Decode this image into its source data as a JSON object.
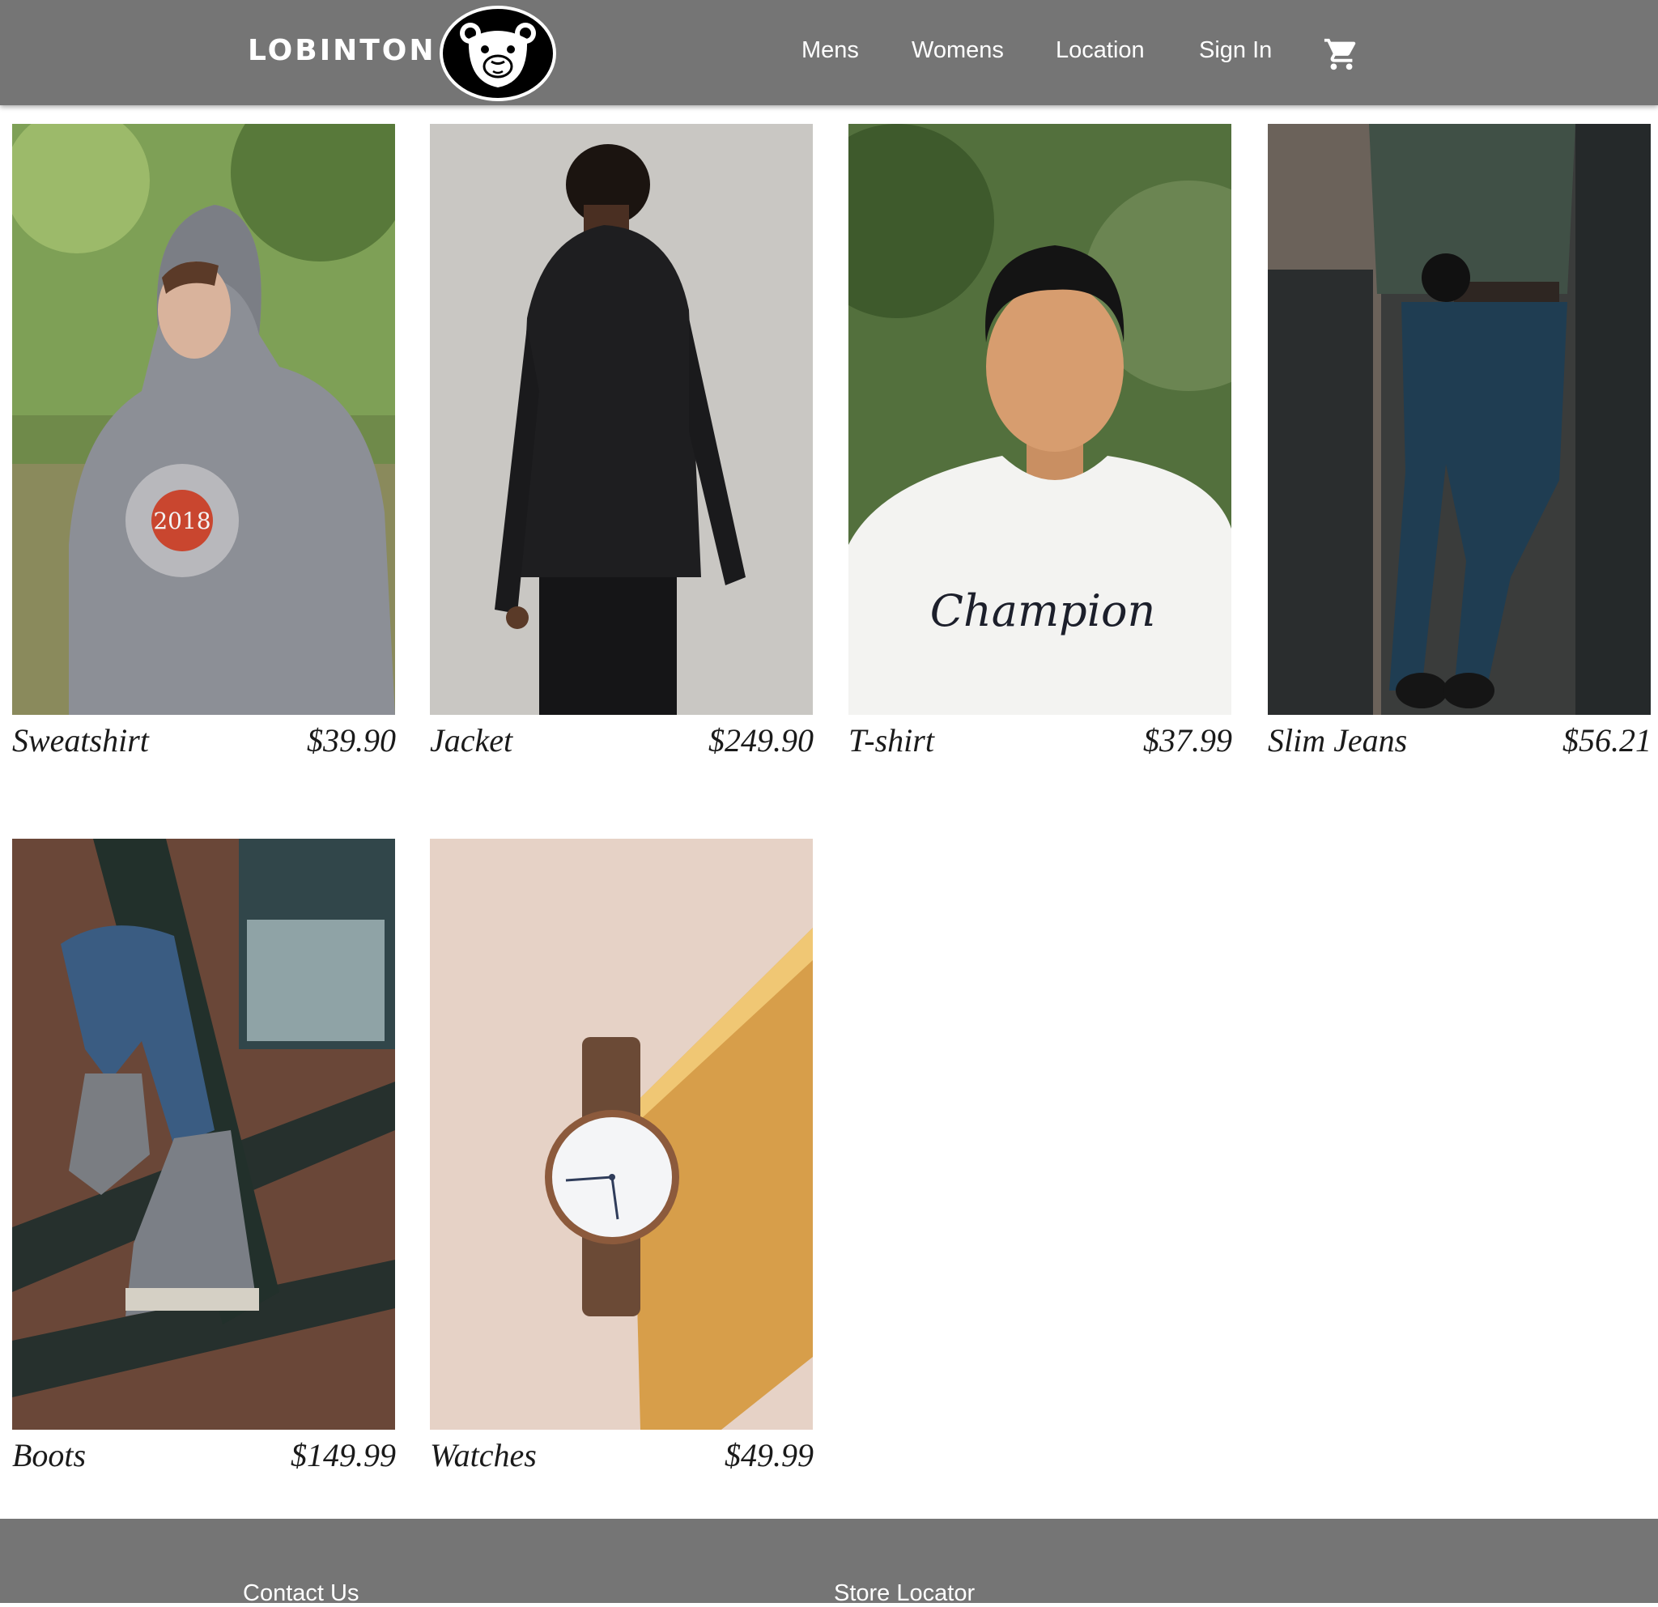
{
  "header": {
    "brand": "LOBINTON",
    "logo_icon": "bear-face-logo-icon",
    "nav": [
      {
        "label": "Mens"
      },
      {
        "label": "Womens"
      },
      {
        "label": "Location"
      },
      {
        "label": "Sign In"
      }
    ],
    "cart_icon": "shopping-cart-icon",
    "background": "#757575"
  },
  "products": [
    {
      "name": "Sweatshirt",
      "price": "$39.90"
    },
    {
      "name": "Jacket",
      "price": "$249.90"
    },
    {
      "name": "T-shirt",
      "price": "$37.99"
    },
    {
      "name": "Slim Jeans",
      "price": "$56.21"
    },
    {
      "name": "Boots",
      "price": "$149.99"
    },
    {
      "name": "Watches",
      "price": "$49.99"
    }
  ],
  "footer": {
    "links": [
      {
        "label": "Contact Us"
      },
      {
        "label": "Store Locator"
      }
    ],
    "background": "#757575"
  }
}
